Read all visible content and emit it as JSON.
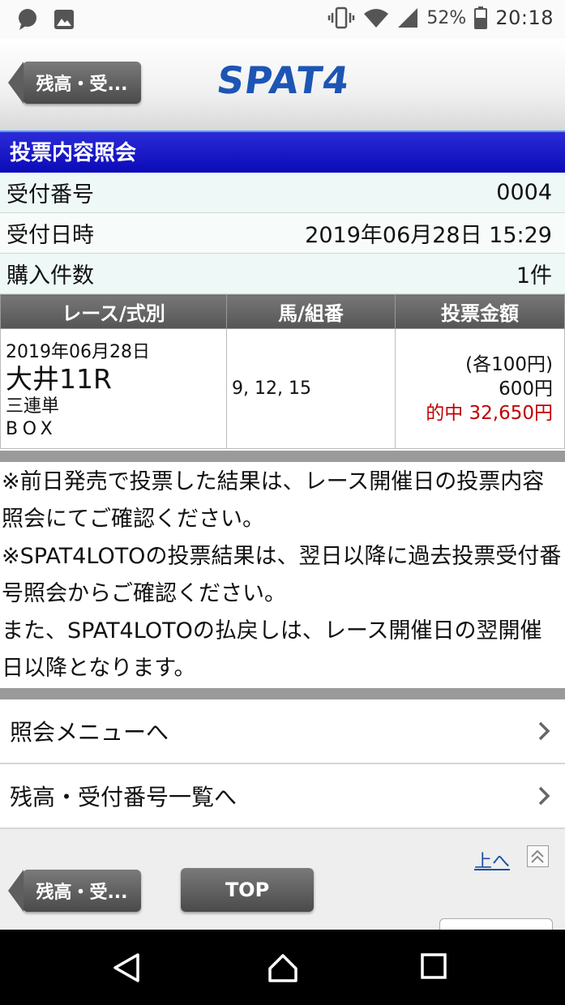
{
  "status_bar": {
    "battery": "52%",
    "time": "20:18",
    "icons": [
      "chat-icon",
      "image-icon",
      "vibrate-icon",
      "wifi-icon",
      "signal-icon",
      "battery-icon"
    ]
  },
  "header": {
    "back_label": "残高・受...",
    "logo_text": "SPAT4"
  },
  "title": "投票内容照会",
  "info": {
    "receipt_label": "受付番号",
    "receipt_value": "0004",
    "datetime_label": "受付日時",
    "datetime_value": "2019年06月28日 15:29",
    "count_label": "購入件数",
    "count_value": "1件"
  },
  "table": {
    "headers": [
      "レース/式別",
      "馬/組番",
      "投票金額"
    ],
    "row": {
      "date": "2019年06月28日",
      "race": "大井11R",
      "bet_type": "三連単",
      "mode": "BOX",
      "combo": "9, 12, 15",
      "each": "(各100円)",
      "total": "600円",
      "hit": "的中 32,650円"
    }
  },
  "notes": [
    "※前日発売で投票した結果は、レース開催日の投票内容照会にてご確認ください。",
    "※SPAT4LOTOの投票結果は、翌日以降に過去投票受付番号照会からご確認ください。",
    "また、SPAT4LOTOの払戻しは、レース開催日の翌開催日以降となります。"
  ],
  "menu": [
    {
      "label": "照会メニューへ"
    },
    {
      "label": "残高・受付番号一覧へ"
    }
  ],
  "footer": {
    "up_label": "上へ",
    "back_label": "残高・受...",
    "top_label": "TOP"
  },
  "colors": {
    "title_bar": "#0a0ab8",
    "logo": "#1d55b4",
    "hit": "#c00000",
    "info_bg": "#eef8f7"
  }
}
